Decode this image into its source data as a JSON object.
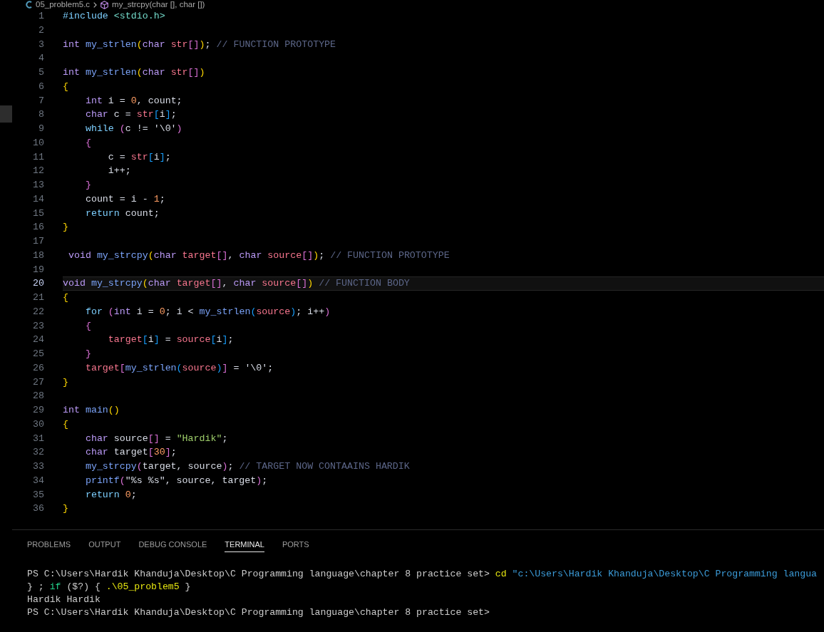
{
  "breadcrumb": {
    "file": "05_problem5.c",
    "symbol": "my_strcpy(char [], char [])"
  },
  "editor": {
    "lines": [
      {
        "number": "1",
        "current": false,
        "tokens": [
          {
            "text": "#include ",
            "kind": "preproc"
          },
          {
            "text": "<stdio.h>",
            "kind": "header"
          }
        ]
      },
      {
        "number": "2",
        "current": false
      },
      {
        "number": "3",
        "current": false,
        "tokens": [
          {
            "text": "int ",
            "kind": "type"
          },
          {
            "text": "my_strlen",
            "kind": "function"
          },
          {
            "text": "(",
            "kind": "bracket1"
          },
          {
            "text": "char ",
            "kind": "type"
          },
          {
            "text": "str",
            "kind": "param"
          },
          {
            "text": "[]",
            "kind": "bracket2"
          },
          {
            "text": ")",
            "kind": "bracket1"
          },
          {
            "text": "; ",
            "kind": "plain"
          },
          {
            "text": "// FUNCTION PROTOTYPE",
            "kind": "comment"
          }
        ]
      },
      {
        "number": "4",
        "current": false
      },
      {
        "number": "5",
        "current": false,
        "tokens": [
          {
            "text": "int ",
            "kind": "type"
          },
          {
            "text": "my_strlen",
            "kind": "function"
          },
          {
            "text": "(",
            "kind": "bracket1"
          },
          {
            "text": "char ",
            "kind": "type"
          },
          {
            "text": "str",
            "kind": "param"
          },
          {
            "text": "[]",
            "kind": "bracket2"
          },
          {
            "text": ")",
            "kind": "bracket1"
          }
        ]
      },
      {
        "number": "6",
        "current": false,
        "tokens": [
          {
            "text": "{",
            "kind": "bracket1"
          }
        ]
      },
      {
        "number": "7",
        "current": false,
        "tokens": [
          {
            "text": "    int",
            "kind": "type"
          },
          {
            "text": " i = ",
            "kind": "plain"
          },
          {
            "text": "0",
            "kind": "number"
          },
          {
            "text": ", count;",
            "kind": "plain"
          }
        ]
      },
      {
        "number": "8",
        "current": false,
        "tokens": [
          {
            "text": "    char",
            "kind": "type"
          },
          {
            "text": " c = ",
            "kind": "plain"
          },
          {
            "text": "str",
            "kind": "param"
          },
          {
            "text": "[",
            "kind": "bracket3"
          },
          {
            "text": "i",
            "kind": "plain"
          },
          {
            "text": "]",
            "kind": "bracket3"
          },
          {
            "text": ";",
            "kind": "plain"
          }
        ]
      },
      {
        "number": "9",
        "current": false,
        "tokens": [
          {
            "text": "    while ",
            "kind": "control"
          },
          {
            "text": "(",
            "kind": "bracket2"
          },
          {
            "text": "c != '\\0'",
            "kind": "plain"
          },
          {
            "text": ")",
            "kind": "bracket2"
          }
        ]
      },
      {
        "number": "10",
        "current": false,
        "tokens": [
          {
            "text": "    {",
            "kind": "bracket2"
          }
        ]
      },
      {
        "number": "11",
        "current": false,
        "tokens": [
          {
            "text": "        c = ",
            "kind": "plain"
          },
          {
            "text": "str",
            "kind": "param"
          },
          {
            "text": "[",
            "kind": "bracket3"
          },
          {
            "text": "i",
            "kind": "plain"
          },
          {
            "text": "]",
            "kind": "bracket3"
          },
          {
            "text": ";",
            "kind": "plain"
          }
        ]
      },
      {
        "number": "12",
        "current": false,
        "tokens": [
          {
            "text": "        i++;",
            "kind": "plain"
          }
        ]
      },
      {
        "number": "13",
        "current": false,
        "tokens": [
          {
            "text": "    }",
            "kind": "bracket2"
          }
        ]
      },
      {
        "number": "14",
        "current": false,
        "tokens": [
          {
            "text": "    count = i - ",
            "kind": "plain"
          },
          {
            "text": "1",
            "kind": "number"
          },
          {
            "text": ";",
            "kind": "plain"
          }
        ]
      },
      {
        "number": "15",
        "current": false,
        "tokens": [
          {
            "text": "    return",
            "kind": "control"
          },
          {
            "text": " count;",
            "kind": "plain"
          }
        ]
      },
      {
        "number": "16",
        "current": false,
        "tokens": [
          {
            "text": "}",
            "kind": "bracket1"
          }
        ]
      },
      {
        "number": "17",
        "current": false
      },
      {
        "number": "18",
        "current": false,
        "tokens": [
          {
            "text": " void ",
            "kind": "type"
          },
          {
            "text": "my_strcpy",
            "kind": "function"
          },
          {
            "text": "(",
            "kind": "bracket1"
          },
          {
            "text": "char ",
            "kind": "type"
          },
          {
            "text": "target",
            "kind": "param"
          },
          {
            "text": "[]",
            "kind": "bracket2"
          },
          {
            "text": ", ",
            "kind": "plain"
          },
          {
            "text": "char ",
            "kind": "type"
          },
          {
            "text": "source",
            "kind": "param"
          },
          {
            "text": "[]",
            "kind": "bracket2"
          },
          {
            "text": ")",
            "kind": "bracket1"
          },
          {
            "text": "; ",
            "kind": "plain"
          },
          {
            "text": "// FUNCTION PROTOTYPE",
            "kind": "comment"
          }
        ]
      },
      {
        "number": "19",
        "current": false
      },
      {
        "number": "20",
        "current": true,
        "tokens": [
          {
            "text": "void ",
            "kind": "type"
          },
          {
            "text": "my_strcpy",
            "kind": "function"
          },
          {
            "text": "(",
            "kind": "bracket1"
          },
          {
            "text": "char ",
            "kind": "type"
          },
          {
            "text": "target",
            "kind": "param"
          },
          {
            "text": "[]",
            "kind": "bracket2"
          },
          {
            "text": ", ",
            "kind": "plain"
          },
          {
            "text": "char ",
            "kind": "type"
          },
          {
            "text": "source",
            "kind": "param"
          },
          {
            "text": "[]",
            "kind": "bracket2"
          },
          {
            "text": ")",
            "kind": "bracket1"
          },
          {
            "text": " // FUNCTION BODY",
            "kind": "comment"
          }
        ]
      },
      {
        "number": "21",
        "current": false,
        "tokens": [
          {
            "text": "{",
            "kind": "bracket1"
          }
        ]
      },
      {
        "number": "22",
        "current": false,
        "tokens": [
          {
            "text": "    for ",
            "kind": "control"
          },
          {
            "text": "(",
            "kind": "bracket2"
          },
          {
            "text": "int",
            "kind": "type"
          },
          {
            "text": " i = ",
            "kind": "plain"
          },
          {
            "text": "0",
            "kind": "number"
          },
          {
            "text": "; i < ",
            "kind": "plain"
          },
          {
            "text": "my_strlen",
            "kind": "function"
          },
          {
            "text": "(",
            "kind": "bracket3"
          },
          {
            "text": "source",
            "kind": "param"
          },
          {
            "text": ")",
            "kind": "bracket3"
          },
          {
            "text": "; i++",
            "kind": "plain"
          },
          {
            "text": ")",
            "kind": "bracket2"
          }
        ]
      },
      {
        "number": "23",
        "current": false,
        "tokens": [
          {
            "text": "    {",
            "kind": "bracket2"
          }
        ]
      },
      {
        "number": "24",
        "current": false,
        "tokens": [
          {
            "text": "        target",
            "kind": "param"
          },
          {
            "text": "[",
            "kind": "bracket3"
          },
          {
            "text": "i",
            "kind": "plain"
          },
          {
            "text": "]",
            "kind": "bracket3"
          },
          {
            "text": " = ",
            "kind": "plain"
          },
          {
            "text": "source",
            "kind": "param"
          },
          {
            "text": "[",
            "kind": "bracket3"
          },
          {
            "text": "i",
            "kind": "plain"
          },
          {
            "text": "]",
            "kind": "bracket3"
          },
          {
            "text": ";",
            "kind": "plain"
          }
        ]
      },
      {
        "number": "25",
        "current": false,
        "tokens": [
          {
            "text": "    }",
            "kind": "bracket2"
          }
        ]
      },
      {
        "number": "26",
        "current": false,
        "tokens": [
          {
            "text": "    target",
            "kind": "param"
          },
          {
            "text": "[",
            "kind": "bracket2"
          },
          {
            "text": "my_strlen",
            "kind": "function"
          },
          {
            "text": "(",
            "kind": "bracket3"
          },
          {
            "text": "source",
            "kind": "param"
          },
          {
            "text": ")",
            "kind": "bracket3"
          },
          {
            "text": "]",
            "kind": "bracket2"
          },
          {
            "text": " = '\\0';",
            "kind": "plain"
          }
        ]
      },
      {
        "number": "27",
        "current": false,
        "tokens": [
          {
            "text": "}",
            "kind": "bracket1"
          }
        ]
      },
      {
        "number": "28",
        "current": false
      },
      {
        "number": "29",
        "current": false,
        "tokens": [
          {
            "text": "int ",
            "kind": "type"
          },
          {
            "text": "main",
            "kind": "function"
          },
          {
            "text": "()",
            "kind": "bracket1"
          }
        ]
      },
      {
        "number": "30",
        "current": false,
        "tokens": [
          {
            "text": "{",
            "kind": "bracket1"
          }
        ]
      },
      {
        "number": "31",
        "current": false,
        "tokens": [
          {
            "text": "    char",
            "kind": "type"
          },
          {
            "text": " source",
            "kind": "plain"
          },
          {
            "text": "[]",
            "kind": "bracket2"
          },
          {
            "text": " = ",
            "kind": "plain"
          },
          {
            "text": "\"Hardik\"",
            "kind": "string"
          },
          {
            "text": ";",
            "kind": "plain"
          }
        ]
      },
      {
        "number": "32",
        "current": false,
        "tokens": [
          {
            "text": "    char",
            "kind": "type"
          },
          {
            "text": " target",
            "kind": "plain"
          },
          {
            "text": "[",
            "kind": "bracket2"
          },
          {
            "text": "30",
            "kind": "number"
          },
          {
            "text": "]",
            "kind": "bracket2"
          },
          {
            "text": ";",
            "kind": "plain"
          }
        ]
      },
      {
        "number": "33",
        "current": false,
        "tokens": [
          {
            "text": "    my_strcpy",
            "kind": "function"
          },
          {
            "text": "(",
            "kind": "bracket2"
          },
          {
            "text": "target, source",
            "kind": "plain"
          },
          {
            "text": ")",
            "kind": "bracket2"
          },
          {
            "text": "; ",
            "kind": "plain"
          },
          {
            "text": "// TARGET NOW CONTAAINS HARDIK",
            "kind": "comment"
          }
        ]
      },
      {
        "number": "34",
        "current": false,
        "tokens": [
          {
            "text": "    printf",
            "kind": "function"
          },
          {
            "text": "(",
            "kind": "bracket2"
          },
          {
            "text": "\"%s %s\", source, target",
            "kind": "plain"
          },
          {
            "text": ")",
            "kind": "bracket2"
          },
          {
            "text": ";",
            "kind": "plain"
          }
        ]
      },
      {
        "number": "35",
        "current": false,
        "tokens": [
          {
            "text": "    return ",
            "kind": "control"
          },
          {
            "text": "0",
            "kind": "number"
          },
          {
            "text": ";",
            "kind": "plain"
          }
        ]
      },
      {
        "number": "36",
        "current": false,
        "tokens": [
          {
            "text": "}",
            "kind": "bracket1"
          }
        ]
      }
    ]
  },
  "panel": {
    "tabs": [
      {
        "label": "PROBLEMS",
        "selected": false
      },
      {
        "label": "OUTPUT",
        "selected": false
      },
      {
        "label": "DEBUG CONSOLE",
        "selected": false
      },
      {
        "label": "TERMINAL",
        "selected": true
      },
      {
        "label": "PORTS",
        "selected": false
      }
    ],
    "terminal": {
      "lines": [
        {
          "tokens": [
            {
              "text": "PS C:\\Users\\Hardik Khanduja\\Desktop\\C Programming language\\chapter 8 practice set> ",
              "kind": "plain"
            },
            {
              "text": "cd ",
              "kind": "command"
            },
            {
              "text": "\"c:\\Users\\Hardik Khanduja\\Desktop\\C Programming langua",
              "kind": "path"
            }
          ]
        },
        {
          "tokens": [
            {
              "text": "} ; ",
              "kind": "plain"
            },
            {
              "text": "if",
              "kind": "keyword"
            },
            {
              "text": " ($?) { ",
              "kind": "plain"
            },
            {
              "text": ".\\05_problem5",
              "kind": "command"
            },
            {
              "text": " }",
              "kind": "plain"
            }
          ]
        },
        {
          "tokens": [
            {
              "text": "Hardik Hardik",
              "kind": "plain"
            }
          ]
        },
        {
          "tokens": [
            {
              "text": "PS C:\\Users\\Hardik Khanduja\\Desktop\\C Programming language\\chapter 8 practice set>",
              "kind": "plain"
            }
          ]
        }
      ]
    }
  }
}
